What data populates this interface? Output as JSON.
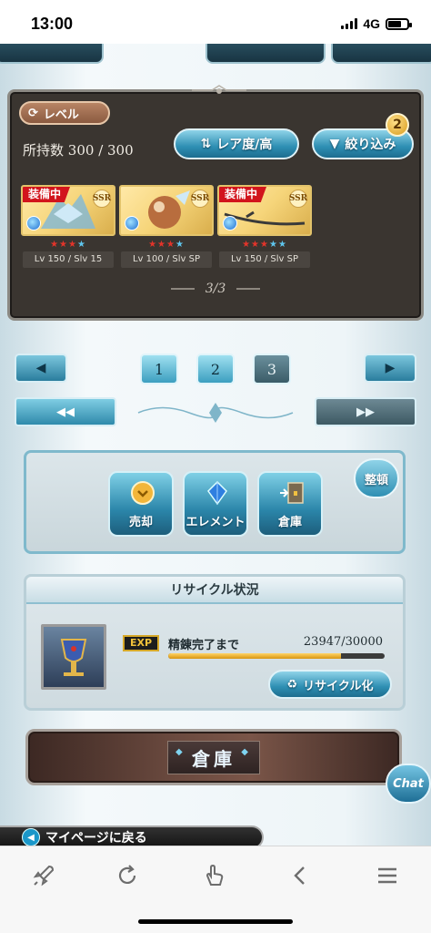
{
  "status_bar": {
    "time": "13:00",
    "network": "4G"
  },
  "inventory": {
    "level_button": "レベル",
    "count_label": "所持数",
    "count_value": "300 / 300",
    "sort_button": "レア度/高",
    "filter_button": "絞り込み",
    "filter_badge": "2",
    "cards": [
      {
        "equipped_label": "装備中",
        "rarity": "SSR",
        "level": "Lv 150 / Slv 15",
        "stars_red": "★★★",
        "stars_blue": "★"
      },
      {
        "equipped_label": "",
        "rarity": "SSR",
        "level": "Lv 100 / Slv SP",
        "stars_red": "★★★",
        "stars_blue": "★"
      },
      {
        "equipped_label": "装備中",
        "rarity": "SSR",
        "level": "Lv 150 / Slv SP",
        "stars_red": "★★★",
        "stars_blue": "★★"
      }
    ],
    "page_indicator": "3/3"
  },
  "pager": {
    "pages": [
      "1",
      "2",
      "3"
    ],
    "current_page": "3"
  },
  "actions": {
    "sell": "売却",
    "element": "エレメント",
    "warehouse": "倉庫",
    "tidy": "整頓"
  },
  "recycle": {
    "title": "リサイクル状況",
    "exp_tag": "EXP",
    "refine_label": "精錬完了まで",
    "refine_value": "23947/30000",
    "progress": 0.7982,
    "button": "リサイクル化"
  },
  "warehouse_banner": "倉庫",
  "chat_button": "Chat",
  "mypage_link": "マイページに戻る",
  "browser_toolbar": [
    "rocket-icon",
    "reload-icon",
    "gesture-icon",
    "back-icon",
    "menu-icon"
  ]
}
